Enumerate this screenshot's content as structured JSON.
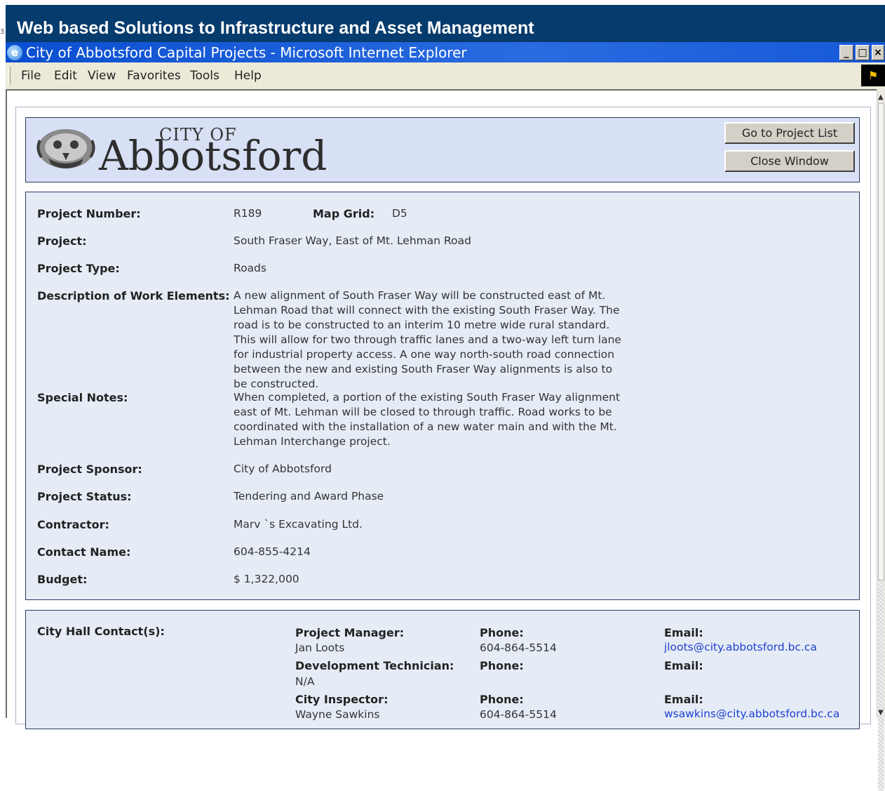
{
  "slide": {
    "title": "Web based Solutions to Infrastructure and Asset Management",
    "edge_text": "3"
  },
  "browser": {
    "window_title": "City of Abbotsford Capital Projects - Microsoft Internet Explorer",
    "min_glyph": "_",
    "max_glyph": "̅ρ",
    "close_glyph": "×",
    "menu": [
      "File",
      "Edit",
      "View",
      "Favorites",
      "Tools",
      "Help"
    ]
  },
  "header": {
    "logo_city_of": "CITY OF",
    "logo_name": "Abbotsford",
    "buttons": {
      "project_list": "Go to Project List",
      "close_window": "Close Window"
    }
  },
  "details": [
    {
      "label": "Project Number:",
      "value": "R189"
    },
    {
      "label": "Project:",
      "value": "South Fraser Way, East of Mt. Lehman Road"
    },
    {
      "label": "Project Type:",
      "value": "Roads"
    },
    {
      "label": "Description of Work Elements:",
      "value": "A new alignment of South Fraser Way will be constructed east of Mt. Lehman Road that will connect with the existing South Fraser Way. The road is to be constructed to an interim 10 metre wide rural standard. This will allow for two through traffic lanes and a two-way left turn lane for industrial property access. A one way north-south road connection between the new and existing South Fraser Way alignments is also to be constructed."
    },
    {
      "label": "Special Notes:",
      "value": "When completed, a portion of the existing South Fraser Way alignment east of Mt. Lehman will be closed to through traffic. Road works to be coordinated with the installation of a new water main and with the Mt. Lehman Interchange project."
    },
    {
      "label": "Project Sponsor:",
      "value": "City of Abbotsford"
    },
    {
      "label": "Project Status:",
      "value": "Tendering and Award Phase"
    },
    {
      "label": "Contractor:",
      "value": "Marv `s Excavating Ltd."
    },
    {
      "label": "Contact Name:",
      "value": "604-855-4214"
    },
    {
      "label": "Budget:",
      "value": "$ 1,322,000"
    }
  ],
  "map_grid": {
    "label": "Map Grid:",
    "value": "D5"
  },
  "contacts": {
    "heading": "City Hall Contact(s):",
    "phone_label": "Phone:",
    "email_label": "Email:",
    "people": [
      {
        "role": "Project Manager:",
        "name": "Jan Loots",
        "phone": "604-864-5514",
        "email": "jloots@city.abbotsford.bc.ca"
      },
      {
        "role": "Development Technician:",
        "name": "N/A",
        "phone": "",
        "email": ""
      },
      {
        "role": "City Inspector:",
        "name": "Wayne Sawkins",
        "phone": "604-864-5514",
        "email": "wsawkins@city.abbotsford.bc.ca"
      }
    ]
  }
}
